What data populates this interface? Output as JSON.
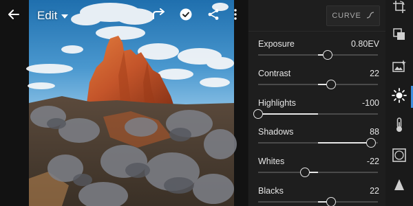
{
  "header": {
    "menu_label": "Edit"
  },
  "panel": {
    "curve_label": "CURVE",
    "adjustments": [
      {
        "id": "exposure",
        "label": "Exposure",
        "value_text": "0.80EV",
        "value": 0.8,
        "min": -5,
        "max": 5
      },
      {
        "id": "contrast",
        "label": "Contrast",
        "value_text": "22",
        "value": 22,
        "min": -100,
        "max": 100
      },
      {
        "id": "highlights",
        "label": "Highlights",
        "value_text": "-100",
        "value": -100,
        "min": -100,
        "max": 100
      },
      {
        "id": "shadows",
        "label": "Shadows",
        "value_text": "88",
        "value": 88,
        "min": -100,
        "max": 100
      },
      {
        "id": "whites",
        "label": "Whites",
        "value_text": "-22",
        "value": -22,
        "min": -100,
        "max": 100
      },
      {
        "id": "blacks",
        "label": "Blacks",
        "value_text": "22",
        "value": 22,
        "min": -100,
        "max": 100
      }
    ]
  },
  "rail": {
    "items": [
      {
        "icon": "crop-rotate-icon",
        "active": false
      },
      {
        "icon": "presets-icon",
        "active": false
      },
      {
        "icon": "auto-enhance-icon",
        "active": false
      },
      {
        "icon": "light-icon",
        "active": true
      },
      {
        "icon": "color-temperature-icon",
        "active": false
      },
      {
        "icon": "effects-vignette-icon",
        "active": false
      },
      {
        "icon": "detail-icon",
        "active": false
      }
    ]
  },
  "colors": {
    "accent": "#3f8fdf",
    "panel_bg": "#1e1e1e",
    "slider_fill": "#e8e8e8",
    "slider_track": "#4a4a4a"
  }
}
